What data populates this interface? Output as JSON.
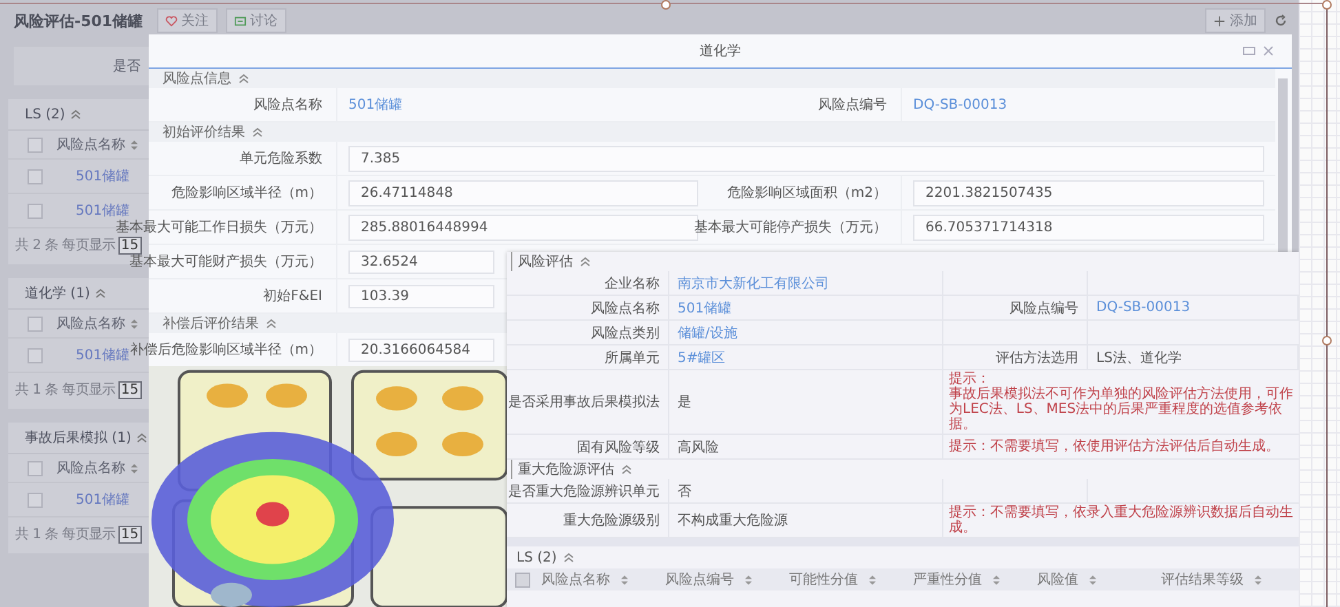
{
  "page": {
    "title": "风险评估-501储罐",
    "actions": [
      {
        "label": "关注",
        "kind": "follow"
      },
      {
        "label": "讨论",
        "kind": "discuss"
      }
    ],
    "add_button": "添加",
    "filter_label": "是否",
    "sections": [
      {
        "title": "LS (2)",
        "column": "风险点名称",
        "all_checked": false,
        "rows": [
          {
            "name": "501储罐",
            "checked": false
          },
          {
            "name": "501储罐",
            "checked": false
          }
        ],
        "pagination": "共 2 条 每页显示",
        "page_size": "15"
      },
      {
        "title": "道化学 (1)",
        "column": "风险点名称",
        "all_checked": false,
        "rows": [
          {
            "name": "501储罐",
            "checked": false
          }
        ],
        "pagination": "共 1 条 每页显示",
        "page_size": "15"
      },
      {
        "title": "事故后果模拟 (1)",
        "column": "风险点名称",
        "all_checked": false,
        "rows": [
          {
            "name": "501储罐",
            "checked": false
          }
        ],
        "pagination": "共 1 条 每页显示",
        "page_size": "15"
      }
    ]
  },
  "dialog": {
    "title": "道化学",
    "groups": [
      {
        "title": "风险点信息",
        "rows": [
          [
            {
              "label": "风险点名称",
              "value": "501储罐",
              "kind": "link"
            },
            {
              "label": "风险点编号",
              "value": "DQ-SB-00013",
              "kind": "link"
            }
          ]
        ]
      },
      {
        "title": "初始评价结果",
        "rows": [
          [
            {
              "label": "单元危险系数",
              "value": "7.385",
              "kind": "input",
              "wide": true
            }
          ],
          [
            {
              "label": "危险影响区域半径（m）",
              "value": "26.47114848",
              "kind": "input"
            },
            {
              "label": "危险影响区域面积（m2）",
              "value": "2201.3821507435",
              "kind": "input"
            }
          ],
          [
            {
              "label": "基本最大可能工作日损失（万元）",
              "value": "285.88016448994",
              "kind": "input"
            },
            {
              "label": "基本最大可能停产损失（万元）",
              "value": "66.705371714318",
              "kind": "input"
            }
          ],
          [
            {
              "label": "基本最大可能财产损失（万元）",
              "value": "32.6524",
              "kind": "input"
            }
          ],
          [
            {
              "label": "初始F&EI",
              "value": "103.39",
              "kind": "input"
            }
          ]
        ]
      },
      {
        "title": "补偿后评价结果",
        "rows": [
          [
            {
              "label": "补偿后危险影响区域半径（m）",
              "value": "20.3166064584",
              "kind": "input"
            }
          ]
        ]
      }
    ]
  },
  "assessment": {
    "sections": [
      {
        "title": "风险评估",
        "rows": [
          {
            "cells": [
              {
                "label": "企业名称",
                "value": "南京市大新化工有限公司",
                "kind": "link"
              }
            ]
          },
          {
            "cells": [
              {
                "label": "风险点名称",
                "value": "501储罐",
                "kind": "link"
              },
              {
                "label": "风险点编号",
                "value": "DQ-SB-00013",
                "kind": "link"
              }
            ]
          },
          {
            "cells": [
              {
                "label": "风险点类别",
                "value": "储罐/设施",
                "kind": "link"
              }
            ]
          },
          {
            "cells": [
              {
                "label": "所属单元",
                "value": "5#罐区",
                "kind": "link"
              },
              {
                "label": "评估方法选用",
                "value": "LS法、道化学",
                "kind": "text"
              }
            ]
          },
          {
            "cells": [
              {
                "label": "是否采用事故后果模拟法",
                "value": "是",
                "kind": "text"
              }
            ],
            "hint": [
              "提示：",
              "事故后果模拟法不可作为单独的风险评估方法使用，可作为LEC法、LS、MES法中的后果严重程度的选值参考依据。"
            ]
          },
          {
            "cells": [
              {
                "label": "固有风险等级",
                "value": "高风险",
                "kind": "text"
              }
            ],
            "hint": [
              "提示：不需要填写，依使用评估方法评估后自动生成。"
            ]
          }
        ]
      },
      {
        "title": "重大危险源评估",
        "rows": [
          {
            "cells": [
              {
                "label": "是否重大危险源辨识单元",
                "value": "否",
                "kind": "text"
              }
            ]
          },
          {
            "cells": [
              {
                "label": "重大危险源级别",
                "value": "不构成重大危险源",
                "kind": "text"
              }
            ],
            "hint": [
              "提示：不需要填写，依录入重大危险源辨识数据后自动生成。"
            ]
          }
        ]
      }
    ],
    "table": {
      "title": "LS (2)",
      "all_checked": false,
      "columns": [
        "风险点名称",
        "风险点编号",
        "可能性分值",
        "严重性分值",
        "风险值",
        "评估结果等级"
      ]
    }
  }
}
